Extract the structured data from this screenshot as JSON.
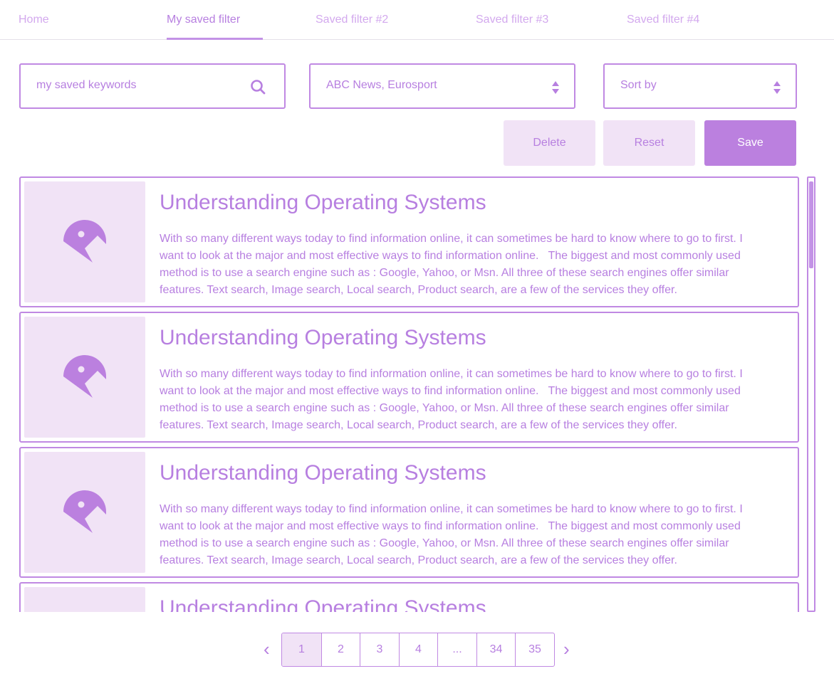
{
  "tabs": [
    {
      "label": "Home"
    },
    {
      "label": "My saved filter"
    },
    {
      "label": "Saved filter #2"
    },
    {
      "label": "Saved filter #3"
    },
    {
      "label": "Saved filter #4"
    }
  ],
  "filters": {
    "keywords_value": "my saved keywords",
    "sources_value": "ABC News, Eurosport",
    "sort_value": "Sort by"
  },
  "actions": {
    "delete_label": "Delete",
    "reset_label": "Reset",
    "save_label": "Save"
  },
  "articles": [
    {
      "title": "Understanding Operating Systems",
      "body": "With so many different ways today to find information online, it can sometimes be hard to know where to go to first. I want to look at the major and most effective ways to find information online.   The biggest and most commonly used method is to use a search engine such as : Google, Yahoo, or Msn. All three of these search engines offer similar features. Text search, Image search, Local search, Product search, are a few of the services they offer."
    },
    {
      "title": "Understanding Operating Systems",
      "body": "With so many different ways today to find information online, it can sometimes be hard to know where to go to first. I want to look at the major and most effective ways to find information online.   The biggest and most commonly used method is to use a search engine such as : Google, Yahoo, or Msn. All three of these search engines offer similar features. Text search, Image search, Local search, Product search, are a few of the services they offer."
    },
    {
      "title": "Understanding Operating Systems",
      "body": "With so many different ways today to find information online, it can sometimes be hard to know where to go to first. I want to look at the major and most effective ways to find information online.   The biggest and most commonly used method is to use a search engine such as : Google, Yahoo, or Msn. All three of these search engines offer similar features. Text search, Image search, Local search, Product search, are a few of the services they offer."
    },
    {
      "title": "Understanding Operating Systems",
      "body": ""
    }
  ],
  "pagination": {
    "prev_label": "‹",
    "next_label": "›",
    "pages": [
      "1",
      "2",
      "3",
      "4",
      "...",
      "34",
      "35"
    ],
    "current": "1"
  },
  "icons": {
    "search": "search-icon",
    "dropdown": "updown-arrows-icon",
    "thumbnail": "image-placeholder-icon"
  },
  "colors": {
    "accent": "#b77fe0",
    "accent_light": "#f1e3f6",
    "tab_inactive": "#d3a9ee"
  }
}
